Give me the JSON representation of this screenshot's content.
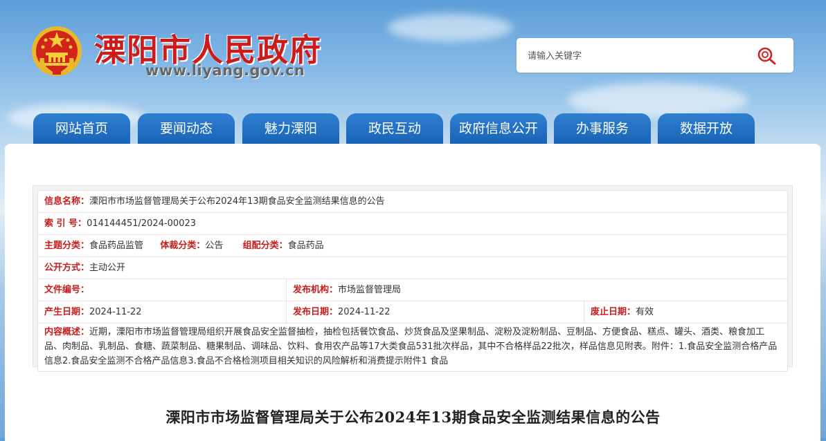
{
  "header": {
    "site_title": "溧阳市人民政府",
    "site_url": "www.liyang.gov.cn",
    "emblem_icon": "national-emblem-icon"
  },
  "search": {
    "placeholder": "请输入关键字",
    "button_icon": "search-icon"
  },
  "nav": {
    "tabs": [
      {
        "label": "网站首页"
      },
      {
        "label": "要闻动态"
      },
      {
        "label": "魅力溧阳"
      },
      {
        "label": "政民互动"
      },
      {
        "label": "政府信息公开"
      },
      {
        "label": "办事服务"
      },
      {
        "label": "数据开放"
      }
    ]
  },
  "info": {
    "name_label": "信息名称：",
    "name_value": "溧阳市市场监督管理局关于公布2024年13期食品安全监测结果信息的公告",
    "index_label": "索 引 号：",
    "index_value": "014144451/2024-00023",
    "topic_label": "主题分类：",
    "topic_value": "食品药品监管",
    "genre_label": "体裁分类：",
    "genre_value": "公告",
    "org_cat_label": "组配分类：",
    "org_cat_value": "食品药品",
    "open_mode_label": "公开方式：",
    "open_mode_value": "主动公开",
    "doc_no_label": "文件编号：",
    "doc_no_value": "",
    "issuer_label": "发布机构：",
    "issuer_value": "市场监督管理局",
    "created_label": "产生日期：",
    "created_value": "2024-11-22",
    "published_label": "发布日期：",
    "published_value": "2024-11-22",
    "expire_label": "废止日期：",
    "expire_value": "有效",
    "summary_label": "内容概述：",
    "summary_value": "近期，溧阳市市场监督管理局组织开展食品安全监督抽检，抽检包括餐饮食品、炒货食品及坚果制品、淀粉及淀粉制品、豆制品、方便食品、糕点、罐头、酒类、粮食加工品、肉制品、乳制品、食糖、蔬菜制品、糖果制品、调味品、饮料、食用农产品等17大类食品531批次样品，其中不合格样品22批次，样品信息见附表。附件：1.食品安全监测合格产品信息2.食品安全监测不合格产品信息3.食品不合格检测项目相关知识的风险解析和消费提示附件1 食品"
  },
  "article": {
    "title": "溧阳市市场监督管理局关于公布2024年13期食品安全监测结果信息的公告"
  },
  "colors": {
    "brand_red": "#cc1b1b",
    "nav_blue": "#1963b7",
    "label_red": "#c71d1d"
  }
}
